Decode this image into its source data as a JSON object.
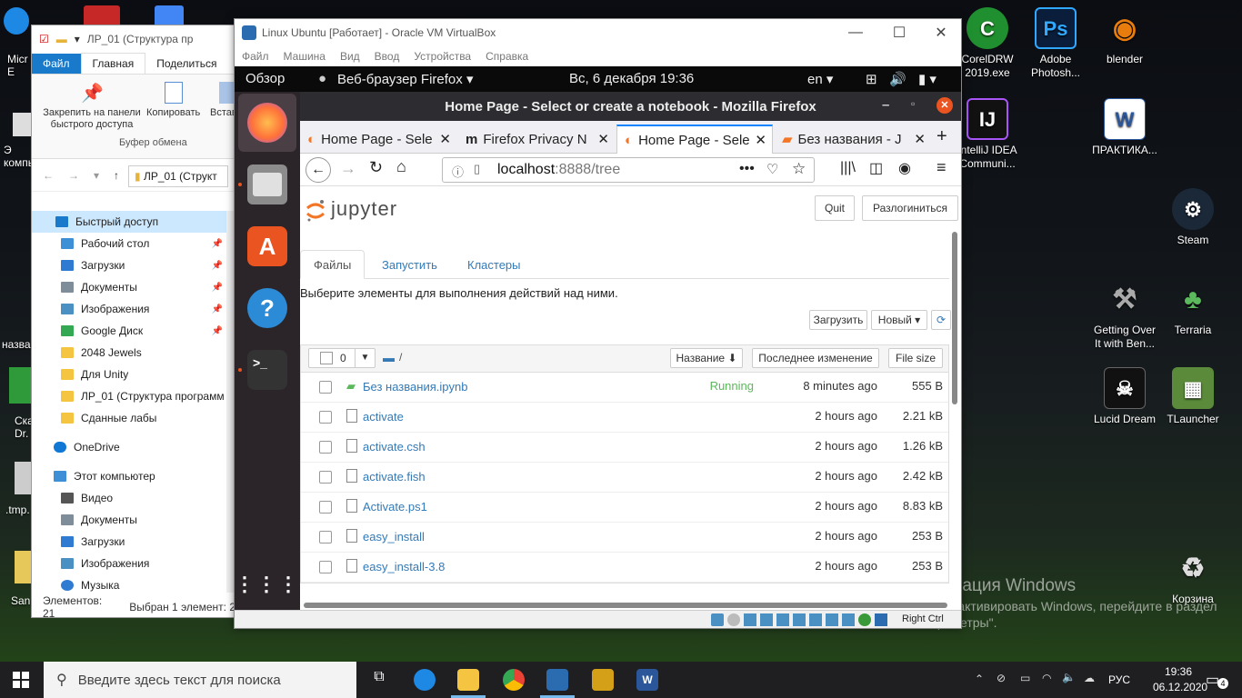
{
  "desktop": {
    "left_partial": [
      "Micr E",
      "Э компь",
      "Ска Dr.",
      ".tmp.",
      "San",
      "назва"
    ],
    "icons": [
      {
        "label": "CorelDRW 2019.exe",
        "icon": "coreldraw-icon",
        "color": "#1f8f2f"
      },
      {
        "label": "Adobe Photosh...",
        "icon": "photoshop-icon",
        "color": "#0a1d3a"
      },
      {
        "label": "blender",
        "icon": "blender-icon",
        "color": "#e87d0d"
      },
      {
        "label": "IntelliJ IDEA Communi...",
        "icon": "intellij-icon",
        "color": "#111"
      },
      {
        "label": "ПРАКТИКА...",
        "icon": "word-doc-icon",
        "color": "#2b579a"
      },
      {
        "label": "Steam",
        "icon": "steam-icon",
        "color": "#1b2838"
      },
      {
        "label": "Getting Over It with Ben...",
        "icon": "hammer-icon",
        "color": "#888"
      },
      {
        "label": "Terraria",
        "icon": "terraria-icon",
        "color": "#3a7a2a"
      },
      {
        "label": "Lucid Dream",
        "icon": "lucid-dream-icon",
        "color": "#222"
      },
      {
        "label": "TLauncher",
        "icon": "tlauncher-icon",
        "color": "#5a8a3a"
      },
      {
        "label": "Корзина",
        "icon": "recycle-bin-icon",
        "color": "#ddd"
      }
    ],
    "activation_title": "Активация Windows",
    "activation_text": "Чтобы активировать Windows, перейдите в раздел \"Параметры\"."
  },
  "taskbar": {
    "search_placeholder": "Введите здесь текст для поиска",
    "lang": "РУС",
    "time": "19:36",
    "date": "06.12.2020",
    "notification_count": "4"
  },
  "explorer": {
    "title": "ЛР_01 (Структура пр",
    "ribbon_tabs": [
      "Файл",
      "Главная",
      "Поделиться"
    ],
    "ribbon_pin": "Закрепить на панели быстрого доступа",
    "ribbon_copy": "Копировать",
    "ribbon_paste": "Вставит",
    "ribbon_group": "Буфер обмена",
    "address": "ЛР_01 (Структ",
    "tree": [
      {
        "label": "Быстрый доступ",
        "color": "#1979ca",
        "pinned": false,
        "selected": true
      },
      {
        "label": "Рабочий стол",
        "color": "#3d8fd6",
        "pinned": true
      },
      {
        "label": "Загрузки",
        "color": "#2e7bd1",
        "pinned": true
      },
      {
        "label": "Документы",
        "color": "#7f8c99",
        "pinned": true
      },
      {
        "label": "Изображения",
        "color": "#4a90c2",
        "pinned": true
      },
      {
        "label": "Google Диск",
        "color": "#34a853",
        "pinned": true
      },
      {
        "label": "2048 Jewels",
        "color": "#f5c542",
        "pinned": false
      },
      {
        "label": "Для Unity",
        "color": "#f5c542",
        "pinned": false
      },
      {
        "label": "ЛР_01 (Структура программ",
        "color": "#f5c542",
        "pinned": false
      },
      {
        "label": "Сданные лабы",
        "color": "#f5c542",
        "pinned": false
      },
      {
        "label": "",
        "color": "",
        "pinned": false
      },
      {
        "label": "OneDrive",
        "color": "#0f78d4",
        "pinned": false
      },
      {
        "label": "",
        "color": "",
        "pinned": false
      },
      {
        "label": "Этот компьютер",
        "color": "#3d8fd6",
        "pinned": false
      },
      {
        "label": "Видео",
        "color": "#555",
        "pinned": false
      },
      {
        "label": "Документы",
        "color": "#7f8c99",
        "pinned": false
      },
      {
        "label": "Загрузки",
        "color": "#2e7bd1",
        "pinned": false
      },
      {
        "label": "Изображения",
        "color": "#4a90c2",
        "pinned": false
      },
      {
        "label": "Музыка",
        "color": "#2e7bd1",
        "pinned": false
      }
    ],
    "status_items": "Элементов: 21",
    "status_selected": "Выбран 1 элемент: 2"
  },
  "vbox": {
    "title": "Linux Ubuntu [Работает] - Oracle VM VirtualBox",
    "menu": [
      "Файл",
      "Машина",
      "Вид",
      "Ввод",
      "Устройства",
      "Справка"
    ],
    "status_hostkey": "Right Ctrl"
  },
  "gnome": {
    "overview": "Обзор",
    "app": "Веб-браузер Firefox ▾",
    "clock": "Вс, 6 декабря  19:36",
    "lang": "en ▾"
  },
  "firefox": {
    "window_title": "Home Page - Select or create a notebook - Mozilla Firefox",
    "tabs": [
      {
        "label": "Home Page - Sele",
        "active": false
      },
      {
        "label": "Firefox Privacy N",
        "active": false
      },
      {
        "label": "Home Page - Sele",
        "active": true
      },
      {
        "label": "Без названия - J",
        "active": false
      }
    ],
    "url_host": "localhost",
    "url_rest": ":8888/tree"
  },
  "jupyter": {
    "logo": "jupyter",
    "quit": "Quit",
    "logout": "Разлогиниться",
    "tabs": [
      "Файлы",
      "Запустить",
      "Кластеры"
    ],
    "hint": "Выберите элементы для выполнения действий над ними.",
    "upload": "Загрузить",
    "new": "Новый ▾",
    "select_count": "0",
    "path": "/",
    "col_name": "Название ⬇",
    "col_modified": "Последнее изменение",
    "col_size": "File size",
    "files": [
      {
        "name": "Без названия.ipynb",
        "status": "Running",
        "time": "8 minutes ago",
        "size": "555 B",
        "notebook": true
      },
      {
        "name": "activate",
        "status": "",
        "time": "2 hours ago",
        "size": "2.21 kB",
        "notebook": false
      },
      {
        "name": "activate.csh",
        "status": "",
        "time": "2 hours ago",
        "size": "1.26 kB",
        "notebook": false
      },
      {
        "name": "activate.fish",
        "status": "",
        "time": "2 hours ago",
        "size": "2.42 kB",
        "notebook": false
      },
      {
        "name": "Activate.ps1",
        "status": "",
        "time": "2 hours ago",
        "size": "8.83 kB",
        "notebook": false
      },
      {
        "name": "easy_install",
        "status": "",
        "time": "2 hours ago",
        "size": "253 B",
        "notebook": false
      },
      {
        "name": "easy_install-3.8",
        "status": "",
        "time": "2 hours ago",
        "size": "253 B",
        "notebook": false
      }
    ]
  }
}
